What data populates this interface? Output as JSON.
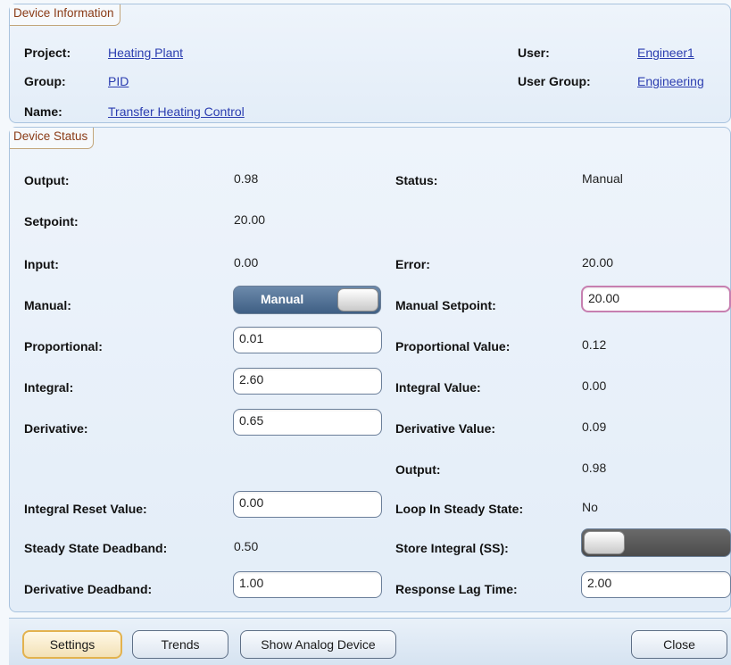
{
  "device_info": {
    "tab_label": "Device Information",
    "project_label": "Project:",
    "project_value": "Heating Plant",
    "group_label": "Group:",
    "group_value": "PID",
    "name_label": "Name:",
    "name_value": "Transfer Heating Control",
    "user_label": "User:",
    "user_value": "Engineer1",
    "user_group_label": "User Group:",
    "user_group_value": "Engineering"
  },
  "device_status": {
    "tab_label": "Device Status",
    "output_label": "Output:",
    "output_value": "0.98",
    "status_label": "Status:",
    "status_value": "Manual",
    "setpoint_label": "Setpoint:",
    "setpoint_value": "20.00",
    "input_label": "Input:",
    "input_value": "0.00",
    "error_label": "Error:",
    "error_value": "20.00",
    "manual_label": "Manual:",
    "manual_toggle_text": "Manual",
    "manual_setpoint_label": "Manual Setpoint:",
    "manual_setpoint_value": "20.00",
    "proportional_label": "Proportional:",
    "proportional_value": "0.01",
    "proportional_value_label": "Proportional Value:",
    "proportional_value_value": "0.12",
    "integral_label": "Integral:",
    "integral_value": "2.60",
    "integral_value_label": "Integral Value:",
    "integral_value_value": "0.00",
    "derivative_label": "Derivative:",
    "derivative_value": "0.65",
    "derivative_value_label": "Derivative Value:",
    "derivative_value_value": "0.09",
    "output2_label": "Output:",
    "output2_value": "0.98",
    "integral_reset_label": "Integral Reset Value:",
    "integral_reset_value": "0.00",
    "loop_steady_label": "Loop In Steady State:",
    "loop_steady_value": "No",
    "steady_deadband_label": "Steady State Deadband:",
    "steady_deadband_value": "0.50",
    "store_integral_label": "Store Integral (SS):",
    "derivative_deadband_label": "Derivative Deadband:",
    "derivative_deadband_value": "1.00",
    "response_lag_label": "Response Lag Time:",
    "response_lag_value": "2.00"
  },
  "buttons": {
    "settings": "Settings",
    "trends": "Trends",
    "show_analog": "Show Analog Device",
    "close": "Close"
  },
  "colors": {
    "tab_text": "#8a3b16",
    "link": "#2b3db0",
    "toggle_on": "#3f5f84",
    "toggle_off": "#5a5a5a",
    "active_button_border": "#e3b24e"
  }
}
